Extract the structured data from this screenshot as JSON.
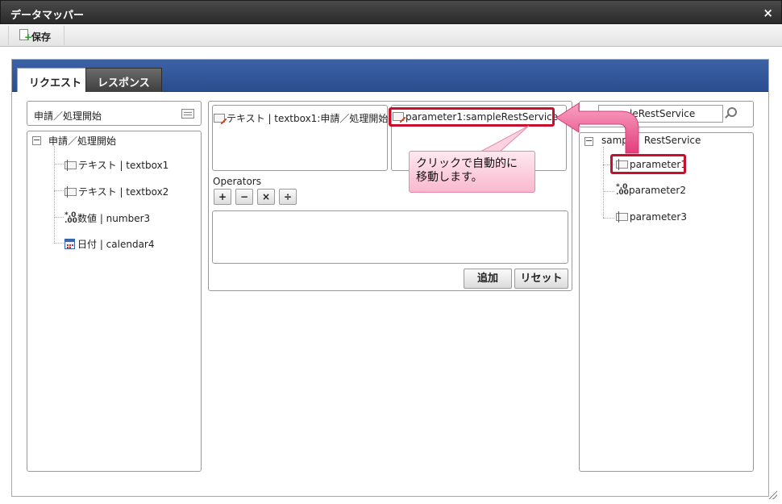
{
  "window": {
    "title": "データマッパー",
    "close_label": "×"
  },
  "toolbar": {
    "save_label": "保存"
  },
  "tabs": [
    {
      "label": "リクエスト"
    },
    {
      "label": "レスポンス"
    }
  ],
  "left": {
    "combo_value": "申請／処理開始",
    "root_label": "申請／処理開始",
    "items": [
      {
        "label": "テキスト | textbox1",
        "icon": "text-field-icon"
      },
      {
        "label": "テキスト | textbox2",
        "icon": "text-field-icon"
      },
      {
        "label": "数値 | number3",
        "icon": "number-field-icon"
      },
      {
        "label": "日付 | calendar4",
        "icon": "calendar-icon"
      }
    ]
  },
  "middle": {
    "source_mapping": "テキスト | textbox1:申請／処理開始",
    "target_mapping": "parameter1:sampleRestService",
    "operators_label": "Operators",
    "operators": [
      "+",
      "−",
      "×",
      "÷"
    ],
    "add_button": "追加",
    "reset_button": "リセット"
  },
  "right": {
    "search_value": "leRestService",
    "root_label_part1": "samp",
    "root_label_part2": "RestService",
    "items": [
      {
        "label": "parameter1",
        "icon": "text-field-icon"
      },
      {
        "label": "parameter2",
        "icon": "number-field-icon"
      },
      {
        "label": "parameter3",
        "icon": "text-field-icon"
      }
    ]
  },
  "callout": {
    "text_line1": "クリックで自動的に",
    "text_line2": "移動します。"
  },
  "colors": {
    "tabbar": "#2f5599",
    "highlight": "#c8102e",
    "arrow": "#ea4f88",
    "callout": "#f9b9ce"
  }
}
